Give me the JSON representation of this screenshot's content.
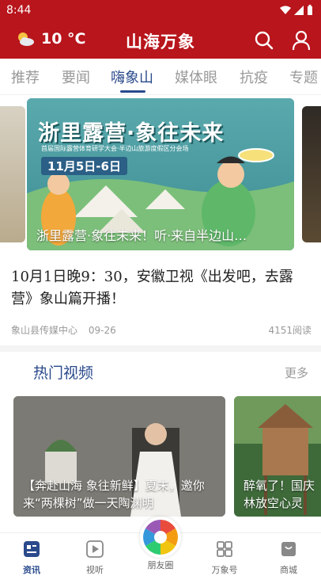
{
  "status_bar": {
    "time": "8:44"
  },
  "header": {
    "weather_temp": "10 °C",
    "weather_icon": "partly-cloudy-icon",
    "app_title": "山海万象",
    "search_icon": "search-icon",
    "profile_icon": "user-icon"
  },
  "tabs": [
    {
      "label": "推荐",
      "active": false
    },
    {
      "label": "要闻",
      "active": false
    },
    {
      "label": "嗨象山",
      "active": true
    },
    {
      "label": "媒体眼",
      "active": false
    },
    {
      "label": "抗疫",
      "active": false
    },
    {
      "label": "专题",
      "active": false
    }
  ],
  "carousel": {
    "main": {
      "caption": "浙里露营·象往未来！听·来自半边山…",
      "poster_title": "浙里露营·象往未来",
      "poster_subtitle": "首届国际露营体育研学大会·半边山旅游度假区分会场",
      "poster_date": "11月5日-6日"
    }
  },
  "article": {
    "headline": "10月1日晚9：30，安徽卫视《出发吧，去露营》象山篇开播！",
    "source": "象山县传媒中心",
    "date": "09-26",
    "reads": "4151阅读"
  },
  "hot_videos": {
    "title": "热门视频",
    "more": "更多",
    "items": [
      {
        "caption": "【奔赴山海 象往新鲜】夏末，邀你来“两棵树”做一天陶渊明"
      },
      {
        "caption": "醉氧了！国庆林放空心灵"
      }
    ]
  },
  "bottom_nav": [
    {
      "label": "资讯",
      "icon": "news-icon",
      "active": true
    },
    {
      "label": "视听",
      "icon": "play-icon",
      "active": false
    },
    {
      "label": "朋友圈",
      "icon": "camera-aperture-icon",
      "active": false
    },
    {
      "label": "万象号",
      "icon": "grid-icon",
      "active": false
    },
    {
      "label": "商城",
      "icon": "shopping-bag-icon",
      "active": false
    }
  ],
  "colors": {
    "brand_red": "#b8151c",
    "accent_blue": "#2a4a8c"
  }
}
